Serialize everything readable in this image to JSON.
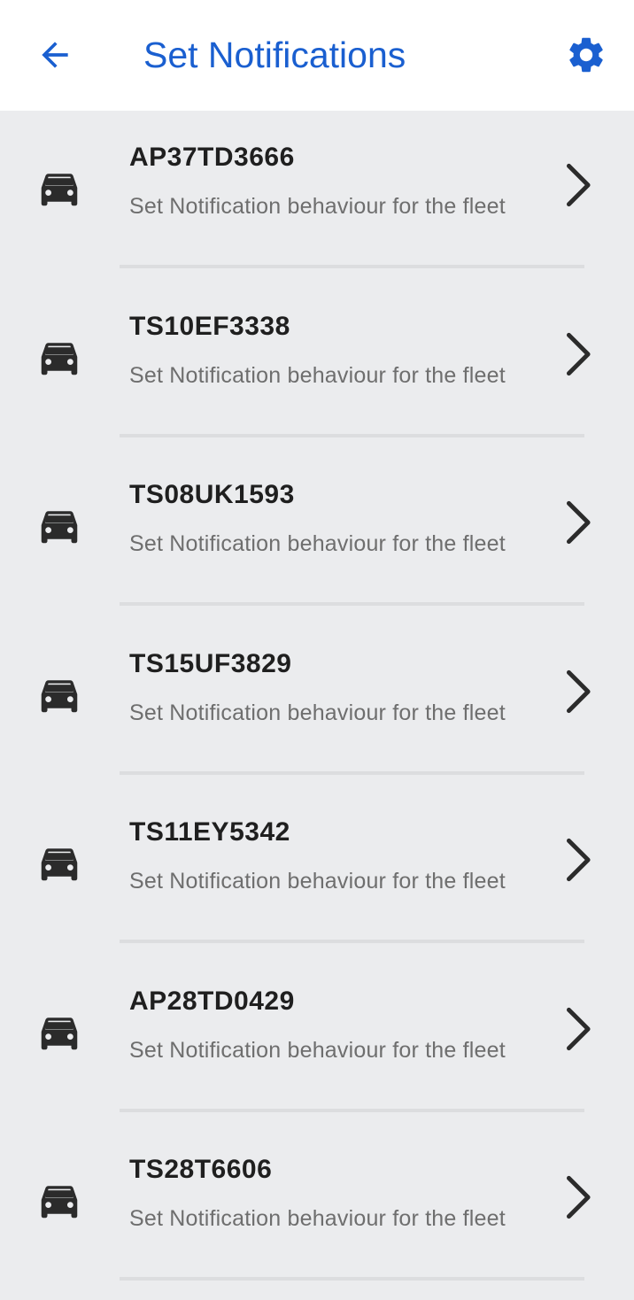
{
  "header": {
    "title": "Set Notifications",
    "back_icon": "arrow-left-icon",
    "settings_icon": "gear-icon",
    "accent_color": "#1a5fd0"
  },
  "vehicles": [
    {
      "plate": "AP37TD3666",
      "subtitle": "Set Notification behaviour for the fleet"
    },
    {
      "plate": "TS10EF3338",
      "subtitle": "Set Notification behaviour for the fleet"
    },
    {
      "plate": "TS08UK1593",
      "subtitle": "Set Notification behaviour for the fleet"
    },
    {
      "plate": "TS15UF3829",
      "subtitle": "Set Notification behaviour for the fleet"
    },
    {
      "plate": "TS11EY5342",
      "subtitle": "Set Notification behaviour for the fleet"
    },
    {
      "plate": "AP28TD0429",
      "subtitle": "Set Notification behaviour for the fleet"
    },
    {
      "plate": "TS28T6606",
      "subtitle": "Set Notification behaviour for the fleet"
    }
  ]
}
